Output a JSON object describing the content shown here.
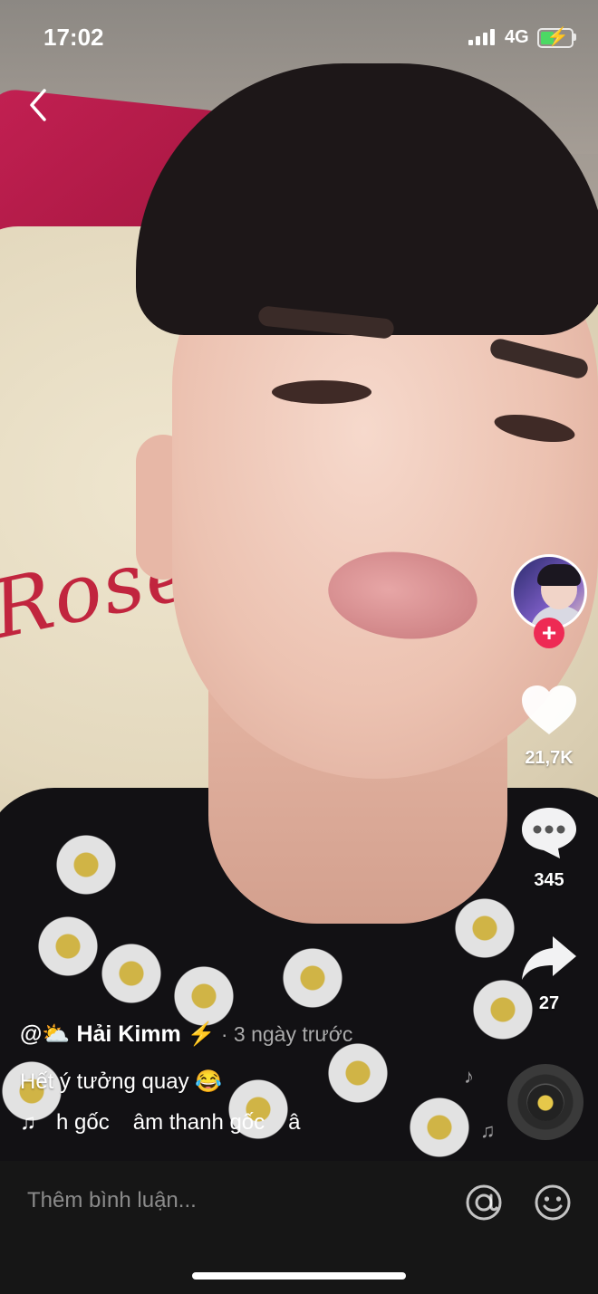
{
  "status_bar": {
    "time": "17:02",
    "network": "4G"
  },
  "video": {
    "author": "@⛅ Hải Kimm ⚡",
    "time_ago": "· 3 ngày trước",
    "caption": "Hết ý tưởng quay 😂",
    "music_texts": [
      "h gốc",
      "âm thanh gốc",
      "â"
    ]
  },
  "actions": {
    "likes": "21,7K",
    "comments": "345",
    "shares": "27"
  },
  "comment_bar": {
    "placeholder": "Thêm bình luận..."
  },
  "icons": {
    "back": "back-chevron-icon",
    "heart": "heart-icon",
    "comment": "comment-bubble-icon",
    "share": "share-arrow-icon",
    "at": "at-mention-icon",
    "emoji": "emoji-icon",
    "music": "music-note-icon"
  },
  "colors": {
    "follow": "#ee2a54",
    "bar_bg": "#161616",
    "battery": "#4cd964"
  }
}
